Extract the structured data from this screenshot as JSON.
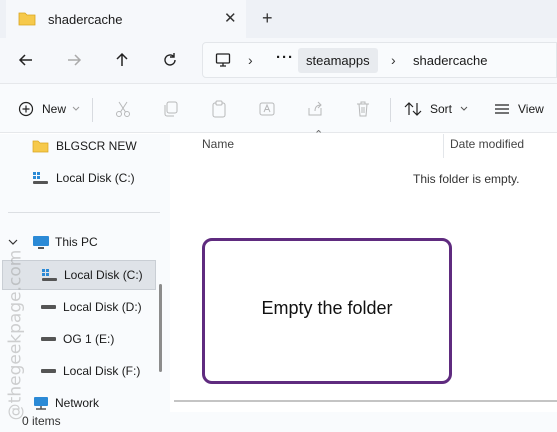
{
  "tab": {
    "title": "shadercache",
    "close": "✕",
    "add": "+"
  },
  "address": {
    "ellipsis": "···",
    "crumbs": [
      "steamapps",
      "shadercache"
    ]
  },
  "toolbar": {
    "new_label": "New",
    "sort_label": "Sort",
    "view_label": "View"
  },
  "sidebar": {
    "items": [
      {
        "label": "BLGSCR NEW"
      },
      {
        "label": "Local Disk (C:)"
      },
      {
        "label": "This PC"
      },
      {
        "label": "Local Disk (C:)"
      },
      {
        "label": "Local Disk (D:)"
      },
      {
        "label": "OG 1 (E:)"
      },
      {
        "label": "Local Disk (F:)"
      },
      {
        "label": "Network"
      }
    ]
  },
  "content": {
    "columns": [
      "Name",
      "Date modified"
    ],
    "empty_message": "This folder is empty."
  },
  "callout": {
    "text": "Empty the folder"
  },
  "status": {
    "items": "0 items"
  },
  "watermark": "@thegeekpage.com",
  "colors": {
    "accent_border": "#5f2b7f",
    "folder": "#f6c94b",
    "pc_blue": "#2b8ad6"
  }
}
